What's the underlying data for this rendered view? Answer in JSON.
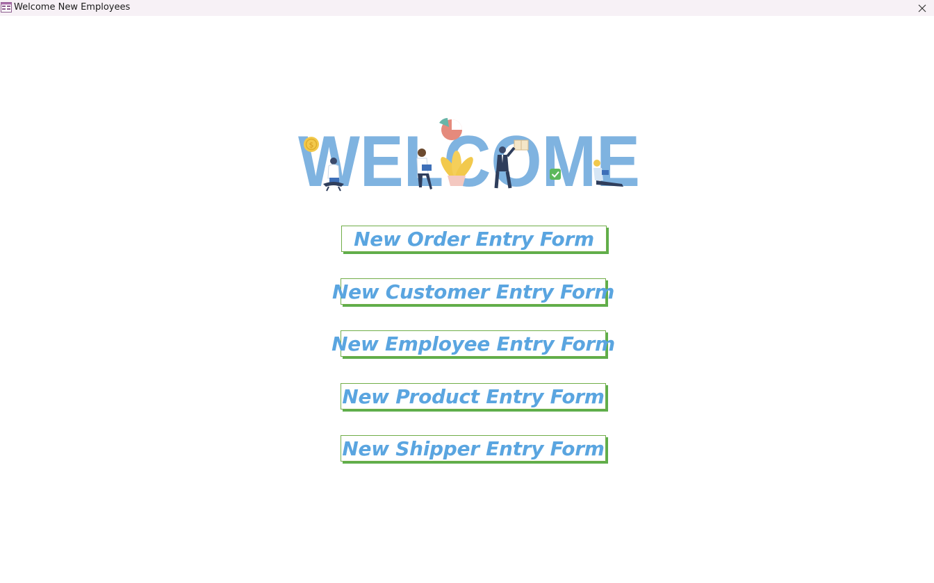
{
  "window": {
    "title": "Welcome New Employees",
    "icon": "form-icon",
    "close_icon": "close-icon"
  },
  "banner": {
    "text": "WELCOME",
    "letter_color": "#7fb3e0"
  },
  "buttons": [
    {
      "label": "New Order Entry Form"
    },
    {
      "label": "New Customer Entry Form"
    },
    {
      "label": "New Employee Entry Form"
    },
    {
      "label": "New Product Entry Form"
    },
    {
      "label": "New Shipper Entry Form"
    }
  ],
  "colors": {
    "button_text": "#5aa5e0",
    "button_border": "#70ad47",
    "titlebar_bg": "#f7f1f6"
  }
}
